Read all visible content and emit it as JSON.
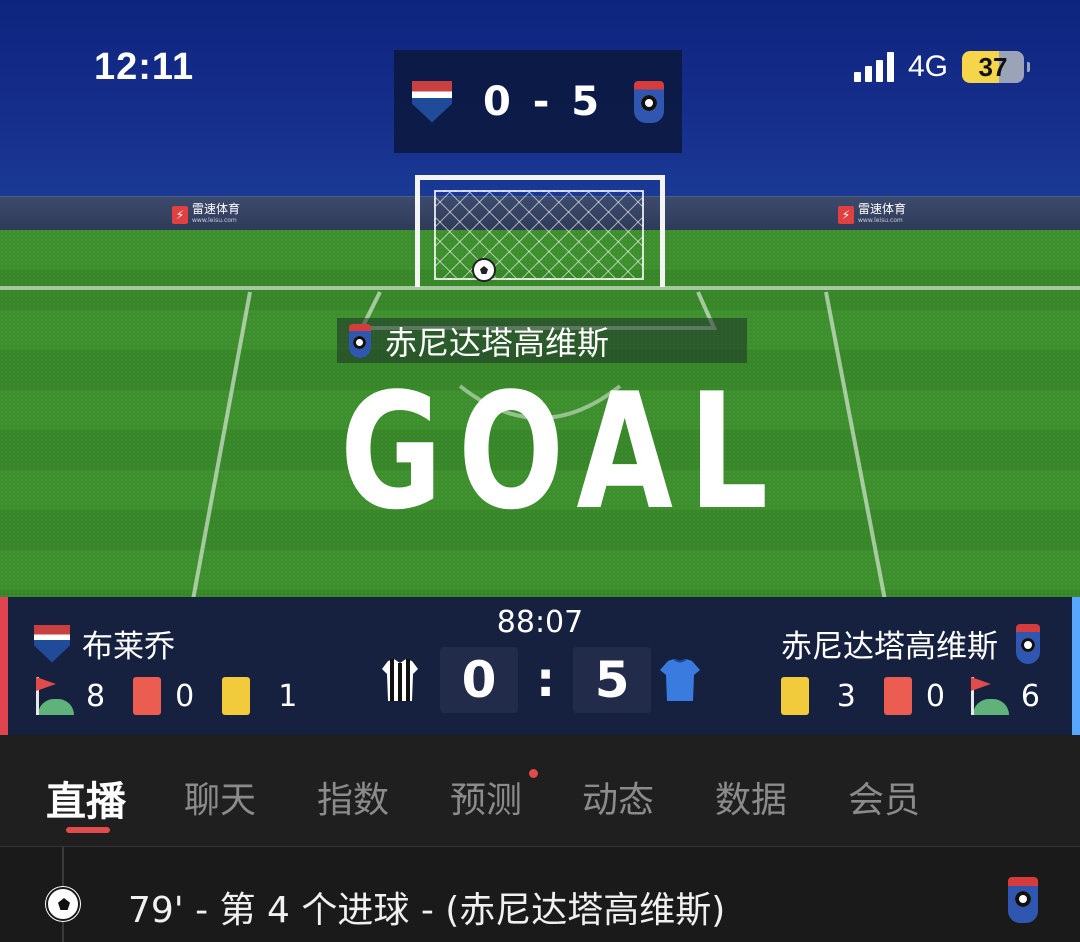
{
  "status_bar": {
    "time": "12:11",
    "network": "4G",
    "battery": "37"
  },
  "field": {
    "mini_score": "0 - 5",
    "ad_brand": "雷速体育",
    "ad_url": "www.leisu.com",
    "scorer_team": "赤尼达塔高维斯",
    "goal_text": "GOAL"
  },
  "match": {
    "clock": "88:07",
    "home": {
      "name": "布莱乔",
      "score": "0",
      "corners": "8",
      "red_cards": "0",
      "yellow_cards": "1"
    },
    "away": {
      "name": "赤尼达塔高维斯",
      "score": "5",
      "corners": "6",
      "red_cards": "0",
      "yellow_cards": "3"
    },
    "colon": ":"
  },
  "tabs": [
    {
      "label": "直播",
      "active": true
    },
    {
      "label": "聊天"
    },
    {
      "label": "指数"
    },
    {
      "label": "预测",
      "dot": true
    },
    {
      "label": "动态"
    },
    {
      "label": "数据"
    },
    {
      "label": "会员"
    }
  ],
  "event": {
    "text": "79' - 第 4 个进球 - (赤尼达塔高维斯)",
    "icon": "soccer-ball-icon"
  },
  "colors": {
    "home_accent": "#e0454f",
    "away_accent": "#58a7ff",
    "tab_active_underline": "#e24b4b",
    "scoreboard_bg": "#162140"
  }
}
